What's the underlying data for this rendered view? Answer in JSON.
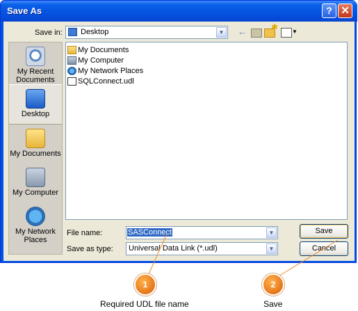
{
  "window": {
    "title": "Save As",
    "help_label": "?",
    "close_label": "✕"
  },
  "save_in": {
    "label": "Save in:",
    "value": "Desktop",
    "icon": "desktop-icon"
  },
  "toolbar": {
    "back_label": "←"
  },
  "places": [
    {
      "label": "My Recent Documents",
      "icon": "recent-documents-icon"
    },
    {
      "label": "Desktop",
      "icon": "desktop-icon"
    },
    {
      "label": "My Documents",
      "icon": "my-documents-icon"
    },
    {
      "label": "My Computer",
      "icon": "my-computer-icon"
    },
    {
      "label": "My Network Places",
      "icon": "network-places-icon"
    }
  ],
  "files": [
    {
      "name": "My Documents",
      "icon": "folder-icon"
    },
    {
      "name": "My Computer",
      "icon": "computer-icon"
    },
    {
      "name": "My Network Places",
      "icon": "network-icon"
    },
    {
      "name": "SQLConnect.udl",
      "icon": "udl-file-icon"
    }
  ],
  "file_name": {
    "label": "File name:",
    "value": "SASConnect"
  },
  "save_as_type": {
    "label": "Save as type:",
    "value": "Universal Data Link (*.udl)"
  },
  "buttons": {
    "save": "Save",
    "cancel": "Cancel"
  },
  "callouts": [
    {
      "number": "1",
      "caption": "Required UDL file name"
    },
    {
      "number": "2",
      "caption": "Save"
    }
  ],
  "colors": {
    "accent": "#0054e3",
    "callout": "#e5761a",
    "selection": "#316ac5"
  }
}
